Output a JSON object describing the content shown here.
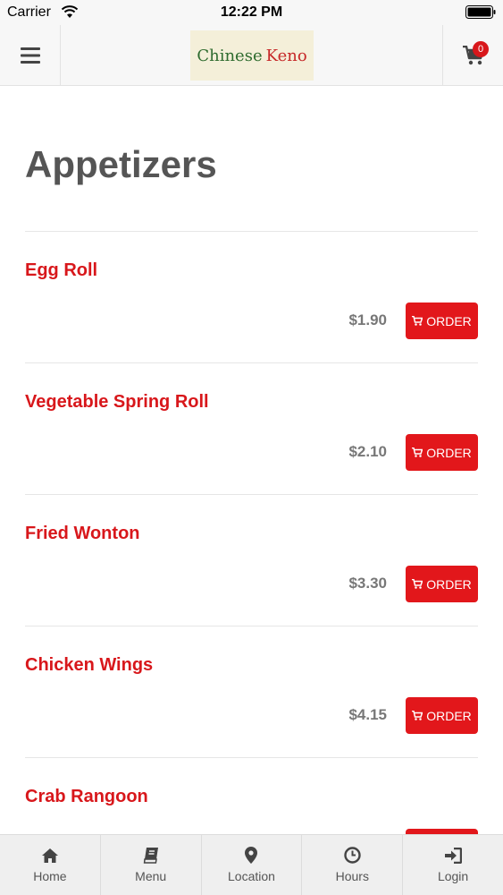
{
  "status_bar": {
    "carrier": "Carrier",
    "time": "12:22 PM"
  },
  "header": {
    "logo_word1": "Chinese",
    "logo_word2": "Keno",
    "cart_count": "0",
    "menu_icon": "hamburger-icon",
    "cart_icon": "cart-icon"
  },
  "page": {
    "title": "Appetizers"
  },
  "items": [
    {
      "name": "Egg Roll",
      "price": "$1.90",
      "order_label": "ORDER"
    },
    {
      "name": "Vegetable Spring Roll",
      "price": "$2.10",
      "order_label": "ORDER"
    },
    {
      "name": "Fried Wonton",
      "price": "$3.30",
      "order_label": "ORDER"
    },
    {
      "name": "Chicken Wings",
      "price": "$4.15",
      "order_label": "ORDER"
    },
    {
      "name": "Crab Rangoon",
      "price": "",
      "order_label": ""
    }
  ],
  "tabs": [
    {
      "label": "Home",
      "icon": "home-icon"
    },
    {
      "label": "Menu",
      "icon": "book-icon"
    },
    {
      "label": "Location",
      "icon": "map-pin-icon"
    },
    {
      "label": "Hours",
      "icon": "clock-icon"
    },
    {
      "label": "Login",
      "icon": "login-icon"
    }
  ],
  "colors": {
    "accent": "#e2171b",
    "item_name": "#d8171b",
    "header_bg": "#f7f7f7",
    "tab_bg": "#efefef"
  }
}
